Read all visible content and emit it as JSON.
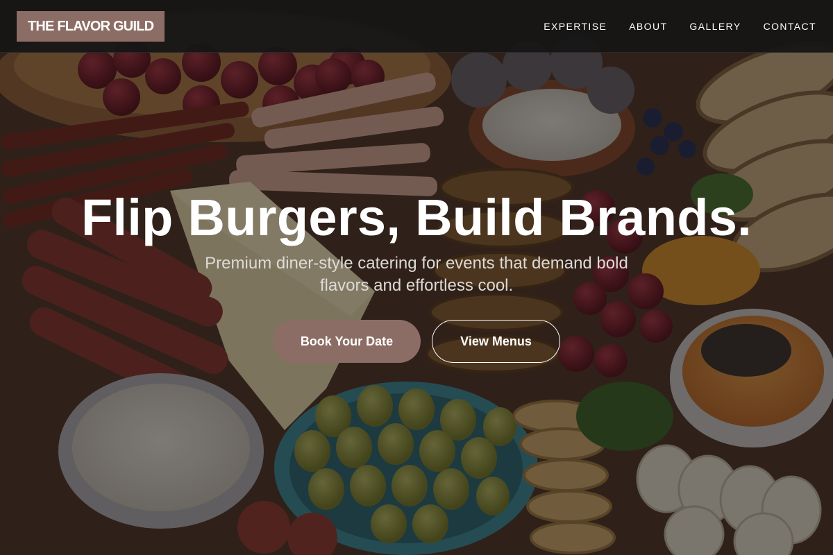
{
  "header": {
    "brand": "THE FLAVOR GUILD",
    "nav": [
      {
        "label": "EXPERTISE"
      },
      {
        "label": "ABOUT"
      },
      {
        "label": "GALLERY"
      },
      {
        "label": "CONTACT"
      }
    ]
  },
  "hero": {
    "title": "Flip Burgers, Build Brands.",
    "subtitle": "Premium diner-style catering for events that demand bold flavors and effortless cool.",
    "primary_button": "Book Your Date",
    "secondary_button": "View Menus"
  },
  "colors": {
    "accent": "#8c6d65",
    "header_background": "#161616",
    "text": "#ffffff"
  }
}
